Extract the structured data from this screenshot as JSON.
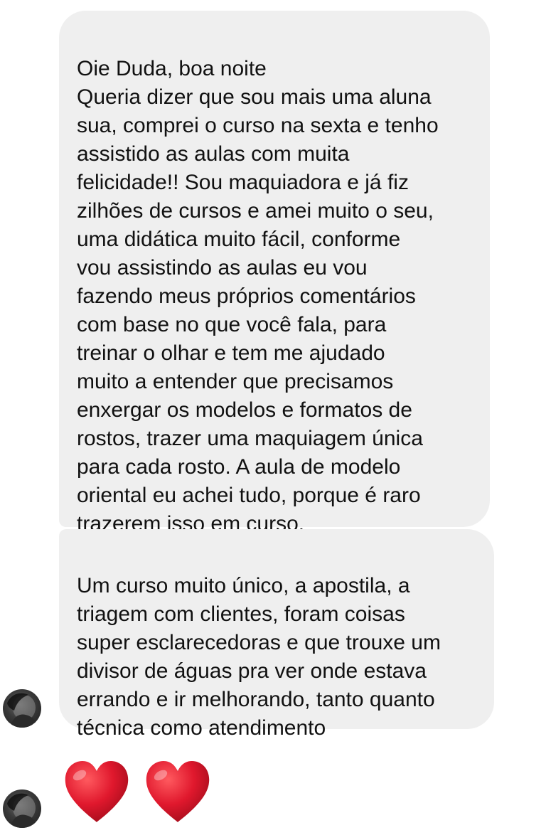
{
  "conversation": {
    "messages": [
      {
        "text": "Oie Duda, boa noite\nQueria dizer que sou mais uma aluna\nsua, comprei o curso na sexta e tenho\nassistido as aulas com muita\nfelicidade!! Sou maquiadora e já fiz\nzilhões de cursos e amei muito o seu,\numa didática muito fácil, conforme\nvou assistindo as aulas eu vou\nfazendo meus próprios comentários\ncom base no que você fala, para\ntreinar o olhar e tem me ajudado\nmuito a entender que precisamos\nenxergar os modelos e formatos de\nrostos, trazer uma maquiagem única\npara cada rosto. A aula de modelo\noriental eu achei tudo, porque é raro\ntrazerem isso em curso."
      },
      {
        "text": "Um curso muito único, a apostila, a\ntriagem com clientes, foram coisas\nsuper esclarecedoras e que trouxe um\ndivisor de águas pra ver onde estava\nerrando e ir melhorando, tanto quanto\ntécnica como atendimento"
      }
    ],
    "reaction_message": {
      "items": [
        {
          "icon": "red-heart-emoji"
        },
        {
          "icon": "red-heart-emoji"
        }
      ]
    },
    "sender_avatar": {
      "icon": "profile-photo"
    }
  },
  "colors": {
    "bubble_background": "#efefef",
    "text": "#111111",
    "heart": "#e0182d",
    "page_background": "#ffffff"
  }
}
